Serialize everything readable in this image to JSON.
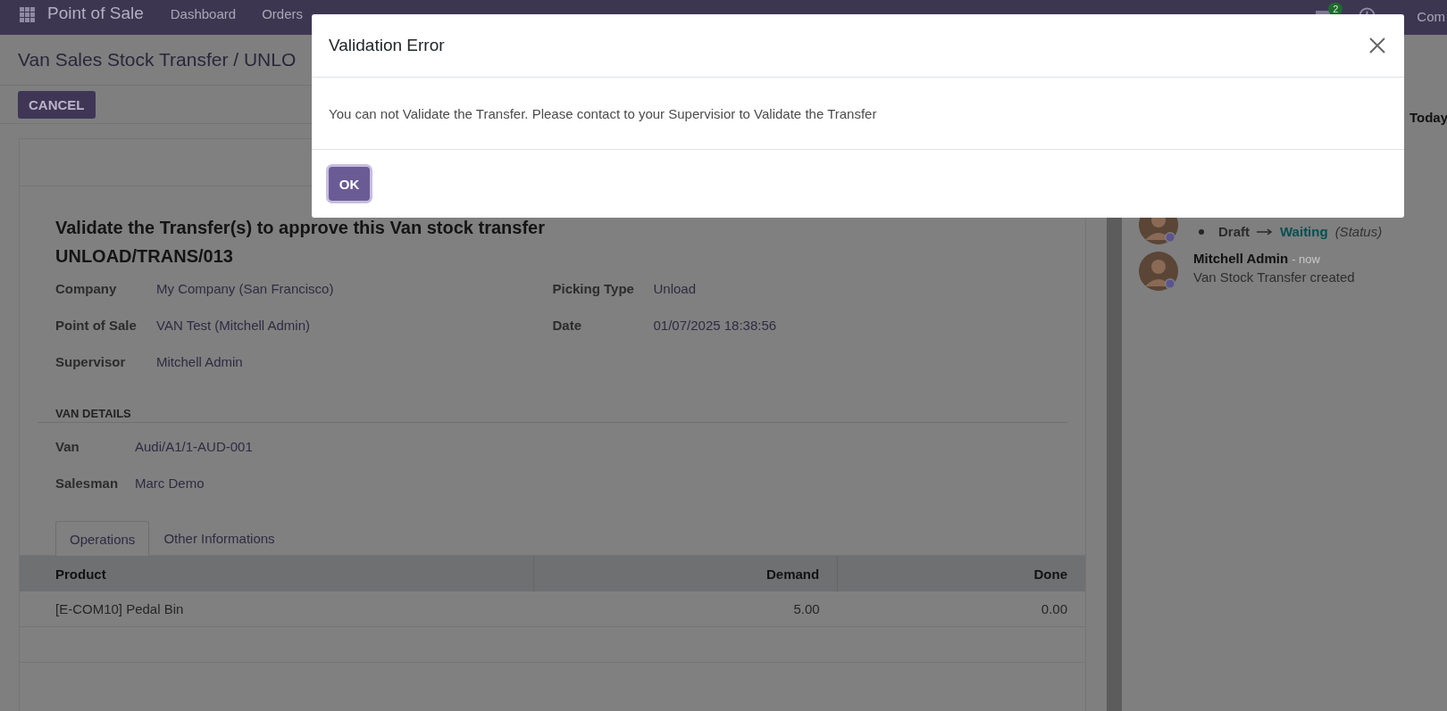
{
  "navbar": {
    "app_name": "Point of Sale",
    "menu": [
      "Dashboard",
      "Orders"
    ],
    "message_count": "2",
    "company": "Com"
  },
  "breadcrumb": "Van Sales Stock Transfer / UNLO",
  "buttons": [
    "CANCEL"
  ],
  "form": {
    "heading": "Validate the Transfer(s) to approve this Van stock transfer",
    "reference": "UNLOAD/TRANS/013",
    "left_fields": [
      {
        "label": "Company",
        "value": "My Company (San Francisco)"
      },
      {
        "label": "Point of Sale",
        "value": "VAN Test (Mitchell Admin)"
      },
      {
        "label": "Supervisor",
        "value": "Mitchell Admin"
      }
    ],
    "right_fields": [
      {
        "label": "Picking Type",
        "value": "Unload"
      },
      {
        "label": "Date",
        "value": "01/07/2025 18:38:56"
      }
    ],
    "van_details": {
      "title": "VAN DETAILS",
      "fields": [
        {
          "label": "Van",
          "value": "Audi/A1/1-AUD-001"
        },
        {
          "label": "Salesman",
          "value": "Marc Demo"
        }
      ]
    },
    "tabs": [
      {
        "label": "Operations",
        "selected": true
      },
      {
        "label": "Other Informations",
        "selected": false
      }
    ],
    "table": {
      "columns": [
        "Product",
        "Demand",
        "Done"
      ],
      "rows": [
        [
          "[E-COM10] Pedal Bin",
          "5.00",
          "0.00"
        ]
      ]
    }
  },
  "chatter": {
    "date_separator": "Today",
    "messages": [
      {
        "kind": "tracking",
        "old_value": "Draft",
        "new_value": "Waiting",
        "field": "(Status)"
      },
      {
        "kind": "note",
        "author": "Mitchell Admin",
        "time": "- now",
        "body": "Van Stock Transfer created"
      }
    ]
  },
  "dialog": {
    "title": "Validation Error",
    "message": "You can not Validate the Transfer. Please contact to your Supervisior to Validate the Transfer",
    "button": "OK"
  }
}
